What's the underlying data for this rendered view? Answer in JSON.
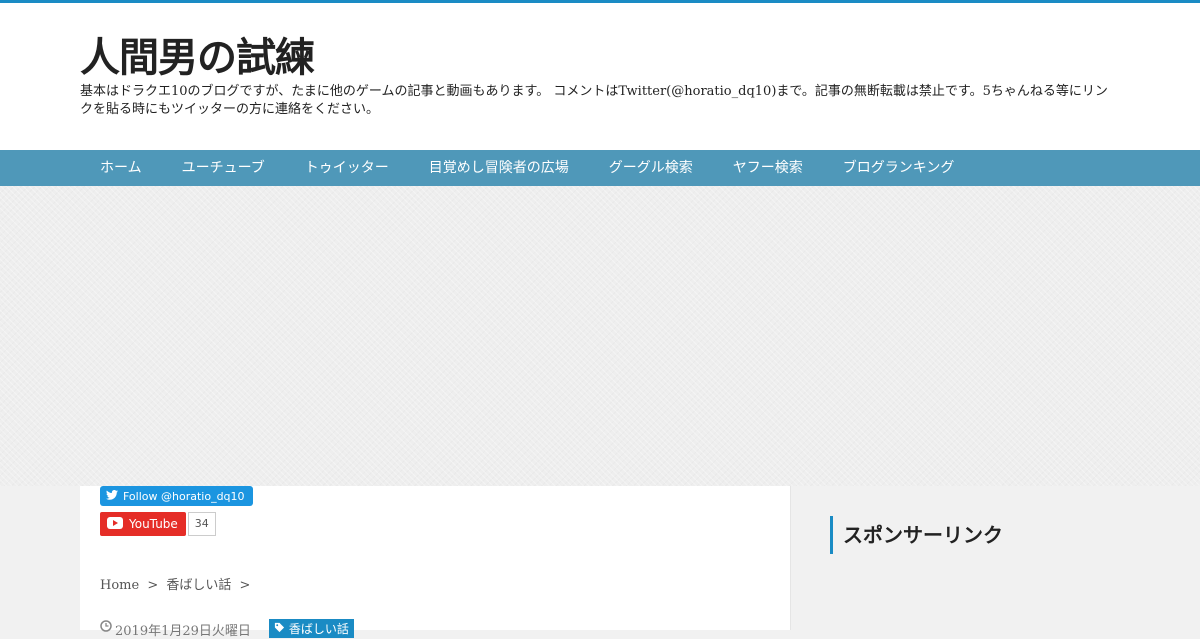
{
  "site": {
    "title": "人間男の試練",
    "description": "基本はドラクエ10のブログですが、たまに他のゲームの記事と動画もあります。 コメントはTwitter(@horatio_dq10)まで。記事の無断転載は禁止です。5ちゃんねる等にリンクを貼る時にもツイッターの方に連絡をください。"
  },
  "nav": {
    "items": [
      {
        "label": "ホーム"
      },
      {
        "label": "ユーチューブ"
      },
      {
        "label": "トゥイッター"
      },
      {
        "label": "目覚めし冒険者の広場"
      },
      {
        "label": "グーグル検索"
      },
      {
        "label": "ヤフー検索"
      },
      {
        "label": "ブログランキング"
      }
    ]
  },
  "social": {
    "twitter_label": "Follow @horatio_dq10",
    "youtube_label": "YouTube",
    "youtube_count": "34"
  },
  "breadcrumb": {
    "home": "Home",
    "sep": ">",
    "category": "香ばしい話"
  },
  "post": {
    "date": "2019年1月29日火曜日",
    "category": "香ばしい話"
  },
  "sidebar": {
    "title": "スポンサーリンク"
  },
  "colors": {
    "accent": "#1a8bc4",
    "nav_bg": "#4f98b9",
    "twitter": "#1b95e0",
    "youtube": "#e52d27"
  }
}
